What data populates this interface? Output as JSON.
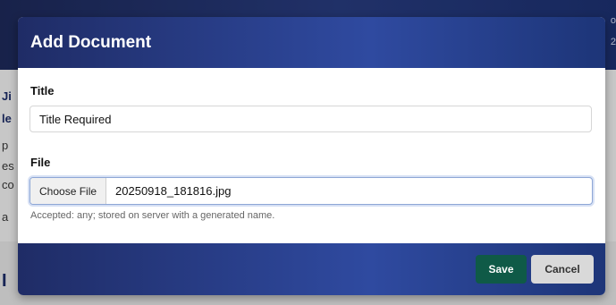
{
  "modal": {
    "title": "Add Document",
    "title_label": "Title",
    "title_value": "Title Required",
    "file_label": "File",
    "choose_file_label": "Choose File",
    "file_name": "20250918_181816.jpg",
    "hint": "Accepted: any; stored on server with a generated name.",
    "save_label": "Save",
    "cancel_label": "Cancel"
  },
  "background": {
    "left_fragments": [
      "Ji",
      "le",
      "p",
      "es",
      "co",
      "a",
      "I"
    ],
    "right_fragments": [
      "o",
      "2"
    ]
  },
  "colors": {
    "header_gradient_start": "#1f2c66",
    "header_gradient_mid": "#2f4aa0",
    "header_gradient_end": "#1d3578",
    "save_button": "#0f5a47",
    "cancel_button": "#d9d9d9"
  }
}
